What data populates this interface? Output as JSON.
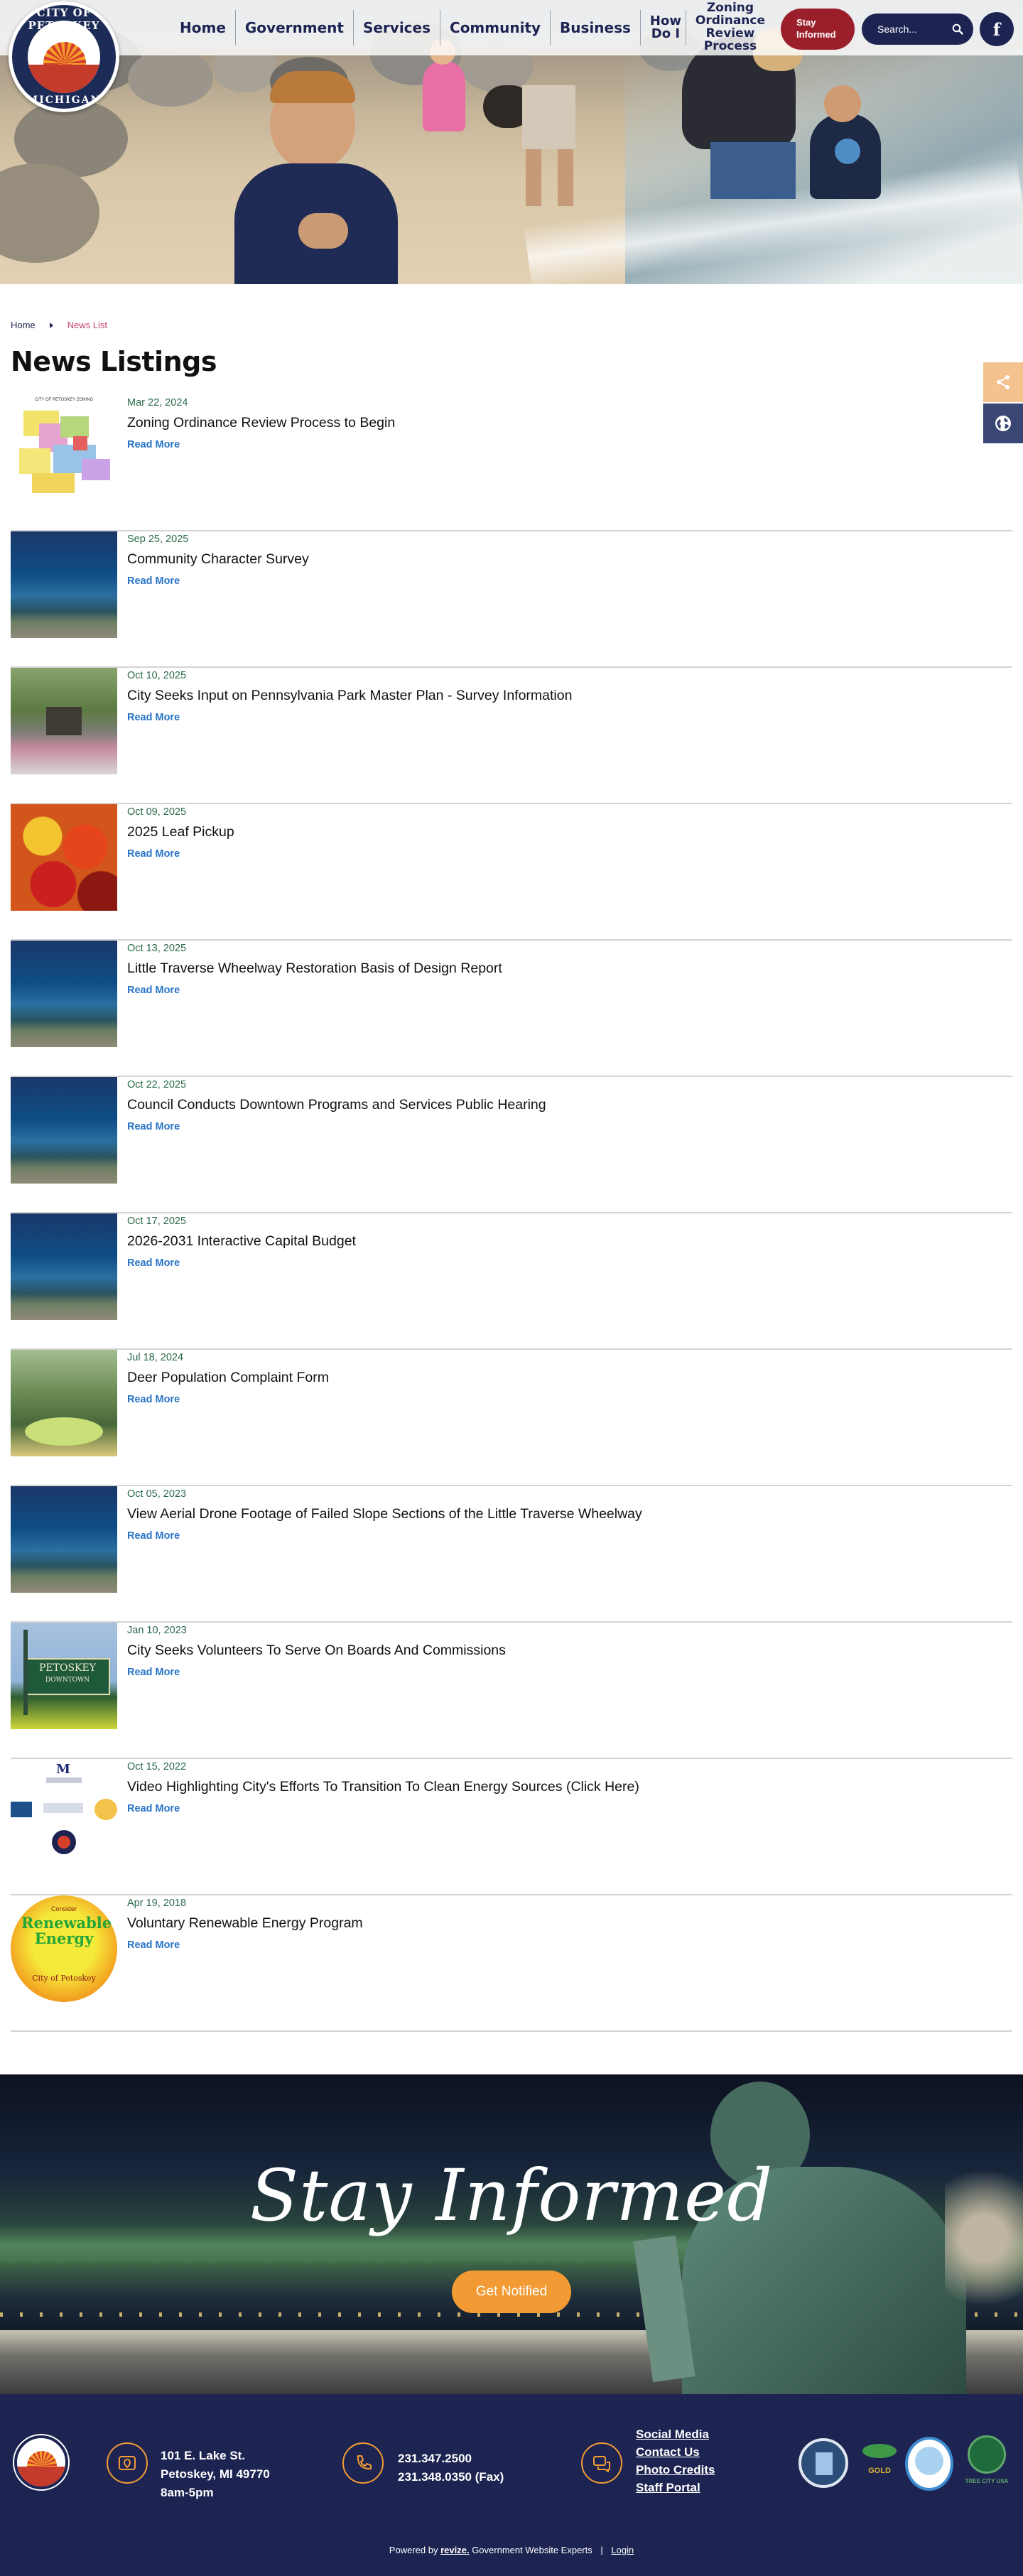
{
  "header": {
    "logo_top_text": "CITY OF PETOSKEY",
    "logo_bottom_text": "MICHIGAN",
    "nav": [
      {
        "label": "Home"
      },
      {
        "label": "Government"
      },
      {
        "label": "Services"
      },
      {
        "label": "Community"
      },
      {
        "label": "Business"
      },
      {
        "label": "How Do I"
      },
      {
        "label": "Zoning Ordinance Review Process"
      }
    ],
    "stay_informed": "Stay Informed",
    "search_placeholder": "Search...",
    "facebook_icon": "facebook-icon"
  },
  "side_tools": {
    "share_icon": "share-icon",
    "translate_icon": "globe-icon"
  },
  "breadcrumb": {
    "home": "Home",
    "current": "News List"
  },
  "page_title": "News Listings",
  "news": [
    {
      "date": "Mar 22, 2024",
      "title": "Zoning Ordinance Review Process to Begin",
      "read_more": "Read More",
      "thumb": "map"
    },
    {
      "date": "Sep 25, 2025",
      "title": "Community Character Survey",
      "read_more": "Read More",
      "thumb": "aerial"
    },
    {
      "date": "Oct 10, 2025",
      "title": "City Seeks Input on Pennsylvania Park Master Plan - Survey Information",
      "read_more": "Read More",
      "thumb": "park"
    },
    {
      "date": "Oct 09, 2025",
      "title": "2025 Leaf Pickup",
      "read_more": "Read More",
      "thumb": "leaf"
    },
    {
      "date": "Oct 13, 2025",
      "title": "Little Traverse Wheelway Restoration Basis of Design Report",
      "read_more": "Read More",
      "thumb": "aerial"
    },
    {
      "date": "Oct 22, 2025",
      "title": "Council Conducts Downtown Programs and Services Public Hearing",
      "read_more": "Read More",
      "thumb": "aerial"
    },
    {
      "date": "Oct 17, 2025",
      "title": "2026-2031 Interactive Capital Budget",
      "read_more": "Read More",
      "thumb": "aerial"
    },
    {
      "date": "Jul 18, 2024",
      "title": "Deer Population Complaint Form",
      "read_more": "Read More",
      "thumb": "deer"
    },
    {
      "date": "Oct 05, 2023",
      "title": "View Aerial Drone Footage of Failed Slope Sections of the Little Traverse Wheelway",
      "read_more": "Read More",
      "thumb": "aerial"
    },
    {
      "date": "Jan 10, 2023",
      "title": "City Seeks Volunteers To Serve On Boards And Commissions",
      "read_more": "Read More",
      "thumb": "sign"
    },
    {
      "date": "Oct 15, 2022",
      "title": "Video Highlighting City's Efforts To Transition To Clean Energy Sources (Click Here)",
      "read_more": "Read More",
      "thumb": "logos"
    },
    {
      "date": "Apr 19, 2018",
      "title": "Voluntary Renewable Energy Program",
      "read_more": "Read More",
      "thumb": "renewable"
    }
  ],
  "thumb_text": {
    "map_caption": "CITY OF PETOSKEY ZONING",
    "sign_city": "PETOSKEY",
    "sign_sub": "DOWNTOWN",
    "renew_top": "Consider",
    "renew_main": "Renewable Energy",
    "renew_city": "City of Petoskey",
    "logo_m": "M"
  },
  "stay_informed_banner": {
    "heading": "Stay Informed",
    "button": "Get Notified"
  },
  "footer": {
    "address_line1": "101 E. Lake St.",
    "address_line2": "Petoskey, MI 49770",
    "hours": "8am-5pm",
    "phone": "231.347.2500",
    "fax": "231.348.0350 (Fax)",
    "links": [
      "Social Media",
      "Contact Us",
      "Photo Credits",
      "Staff Portal"
    ],
    "badge_gold": "GOLD",
    "badge_tree": "TREE CITY USA",
    "powered_prefix": "Powered by",
    "powered_brand": "revize.",
    "powered_suffix": "Government Website Experts",
    "separator": "|",
    "login": "Login"
  },
  "colors": {
    "navy": "#1d2452",
    "stay_red": "#9b1f2b",
    "accent_orange": "#f29a34",
    "link_blue": "#2874c7",
    "date_green": "#2a6a4a",
    "breadcrumb_pink": "#c8446b"
  }
}
